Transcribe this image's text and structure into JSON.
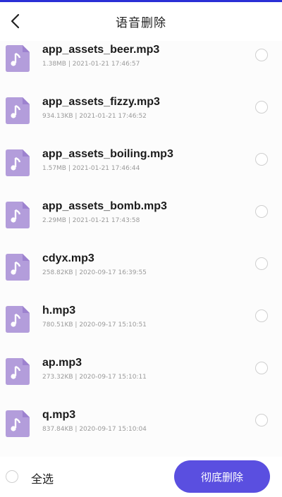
{
  "header": {
    "title": "语音删除"
  },
  "files": [
    {
      "name": "app_assets_beer.mp3",
      "meta": "1.38MB | 2021-01-21 17:46:57"
    },
    {
      "name": "app_assets_fizzy.mp3",
      "meta": "934.13KB | 2021-01-21 17:46:52"
    },
    {
      "name": "app_assets_boiling.mp3",
      "meta": "1.57MB | 2021-01-21 17:46:44"
    },
    {
      "name": "app_assets_bomb.mp3",
      "meta": "2.29MB | 2021-01-21 17:43:58"
    },
    {
      "name": "cdyx.mp3",
      "meta": "258.82KB | 2020-09-17 16:39:55"
    },
    {
      "name": "h.mp3",
      "meta": "780.51KB | 2020-09-17 15:10:51"
    },
    {
      "name": "ap.mp3",
      "meta": "273.32KB | 2020-09-17 15:10:11"
    },
    {
      "name": "q.mp3",
      "meta": "837.84KB | 2020-09-17 15:10:04"
    }
  ],
  "footer": {
    "select_all": "全选",
    "delete_label": "彻底删除"
  },
  "colors": {
    "accent": "#5a4fe0",
    "icon_purple": "#b39ddb",
    "top_bar": "#2a2fd6"
  }
}
